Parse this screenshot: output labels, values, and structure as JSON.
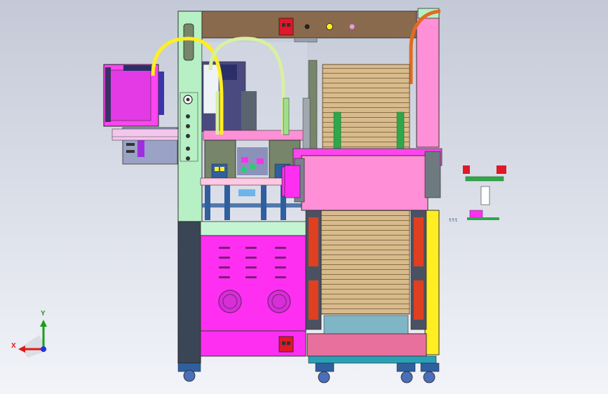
{
  "app": {
    "title": ""
  },
  "colors": {
    "bg_top": "#c3c8d6",
    "bg_bottom": "#f1f3f8",
    "frame_light_green": "#b6f0c4",
    "frame_brown": "#8a6a4c",
    "magenta": "#ff2ff2",
    "pink": "#ff8fd6",
    "dark_slate": "#3a4556",
    "blue_steel": "#2f5f9e",
    "tan_tray": "#d6b98a",
    "yellow": "#ffee22",
    "red": "#e0102a",
    "green": "#2ea84a",
    "olive": "#77866a"
  },
  "triad": {
    "x_label": "X",
    "y_label": "Y",
    "x_color": "#e01818",
    "y_color": "#18a018",
    "z_color": "#1838e0"
  },
  "icons": {
    "triad": "coordinate-triad-icon"
  }
}
